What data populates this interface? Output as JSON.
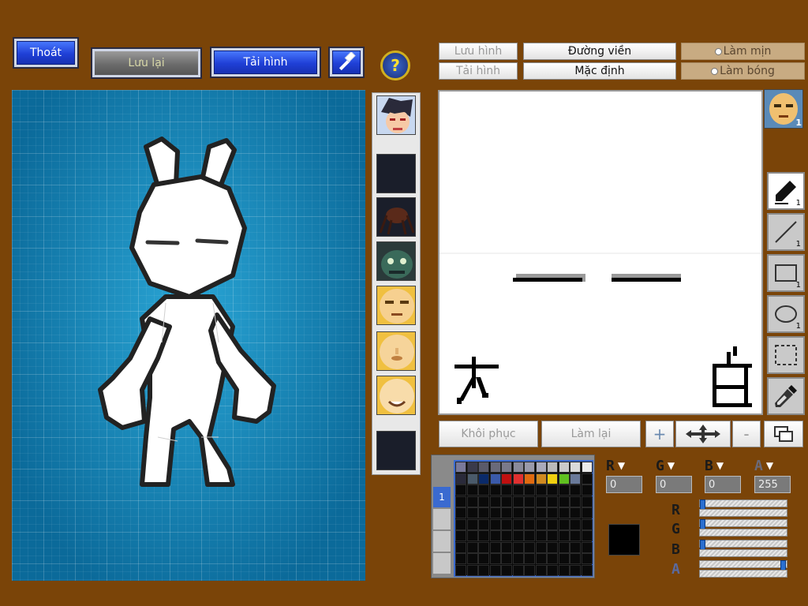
{
  "toolbar": {
    "exit_label": "Thoát",
    "save_label": "Lưu lại",
    "load_label": "Tải hình"
  },
  "top_tabs": {
    "save_image": "Lưu hình",
    "load_image": "Tải hình",
    "outline": "Đường viền",
    "default": "Mặc định",
    "smooth": "Làm mịn",
    "shade": "Làm bóng"
  },
  "avatar_badge": "1",
  "tool_numbers": {
    "pen": "1",
    "line": "1",
    "rect": "1",
    "ellipse": "1"
  },
  "actions": {
    "restore": "Khôi phục",
    "redo": "Làm lại"
  },
  "color": {
    "r_value": "0",
    "g_value": "0",
    "b_value": "0",
    "a_value": "255",
    "current": "#000000",
    "r_slider": 0,
    "g_slider": 0,
    "b_slider": 0,
    "a_slider": 1.0
  },
  "palette_tab_number": "1",
  "palette_colors": [
    "#7a7a9a",
    "#3a3a4a",
    "#5a5a6a",
    "#6a6a7a",
    "#7a7a8a",
    "#8a8a9a",
    "#9a9aaa",
    "#aaaaba",
    "#bababa",
    "#cacaca",
    "#dadada",
    "#eaeaea",
    "#2a2a3a",
    "#4a5a6a",
    "#0a2a6a",
    "#3a5aaa",
    "#c01010",
    "#e03030",
    "#e06a10",
    "#d08a20",
    "#f0d010",
    "#60c020",
    "#6a7a9a"
  ]
}
